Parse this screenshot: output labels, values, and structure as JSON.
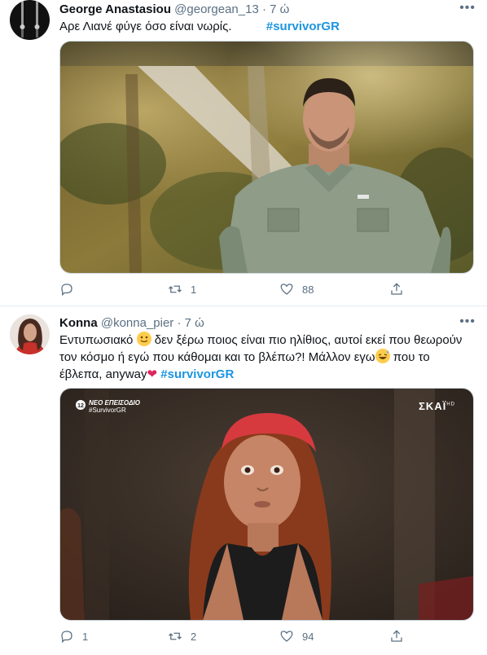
{
  "tweets": [
    {
      "author_name": "George Anastasiou",
      "handle": "@georgean_13",
      "separator": "·",
      "time": "7 ώ",
      "more_icon": "more-horizontal-icon",
      "text": "Αρε Λιανέ φύγε όσο είναι νωρίς.",
      "hashtag": "#survivorGR",
      "reply_count": "",
      "retweet_count": "1",
      "like_count": "88"
    },
    {
      "author_name": "Konna",
      "handle": "@konna_pier",
      "separator": "·",
      "time": "7 ώ",
      "text_part1": "Εντυπωσιακό",
      "text_part2": " δεν ξέρω ποιος είναι πιο ηλίθιος, αυτοί εκεί που θεωρούν τον κόσμο ή εγώ που κάθομαι και το βλέπω?! Μάλλον εγω",
      "text_part3": " που το έβλεπα, anyway",
      "hashtag": "#survivorGR",
      "video_badge_line1": "ΝΕΟ ΕΠΕΙΣΟΔΙΟ",
      "video_badge_line2": "#SurvivorGR",
      "channel_logo": "ΣΚΑΪ",
      "channel_hd": "HD",
      "reply_count": "1",
      "retweet_count": "2",
      "like_count": "94"
    }
  ],
  "colors": {
    "hashtag": "#1b95e0",
    "secondary_text": "#5b7083",
    "divider": "#e6ecf0",
    "heart_emoji": "#e0245e"
  }
}
